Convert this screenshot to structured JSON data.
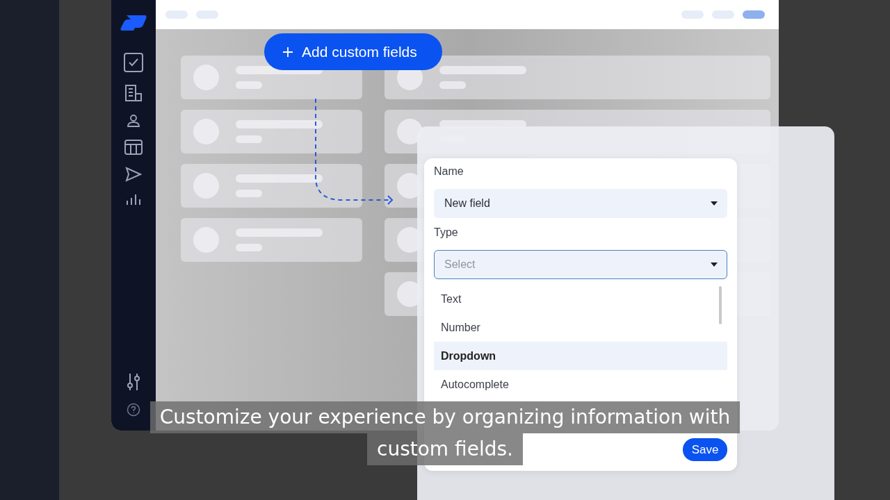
{
  "add_button": {
    "label": "Add custom fields"
  },
  "dialog": {
    "name_label": "Name",
    "name_field": {
      "value": "New field"
    },
    "type_label": "Type",
    "type_field": {
      "placeholder": "Select",
      "focused": true
    },
    "options": [
      {
        "label": "Text",
        "selected": false
      },
      {
        "label": "Number",
        "selected": false
      },
      {
        "label": "Dropdown",
        "selected": true
      },
      {
        "label": "Autocomplete",
        "selected": false
      }
    ],
    "save_button": "Save"
  },
  "caption": {
    "lines": [
      "Customize your experience by organizing information with",
      "custom fields."
    ]
  }
}
